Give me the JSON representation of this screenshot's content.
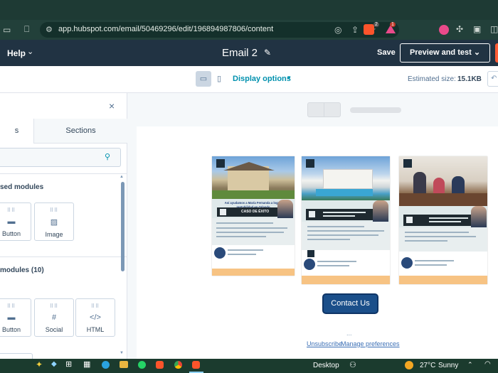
{
  "browser": {
    "url": "app.hubspot.com/email/50469296/edit/196894987806/content",
    "brave_badge": "2",
    "alert_badge": "1"
  },
  "header": {
    "help_label": "Help",
    "email_title": "Email 2",
    "save_label": "Save",
    "preview_label": "Preview and test"
  },
  "toolbar": {
    "display_options_label": "Display options",
    "estimated_size_label": "Estimated size:",
    "estimated_size_value": "15.1KB"
  },
  "panel": {
    "tab_modules": "s",
    "tab_sections": "Sections",
    "section1_title": "sed modules",
    "section1_modules": [
      {
        "label": "Button",
        "icon": "button-icon"
      },
      {
        "label": "Image",
        "icon": "image-icon"
      }
    ],
    "section2_title": "modules (10)",
    "section2_modules": [
      {
        "label": "Button",
        "icon": "button-icon"
      },
      {
        "label": "Social",
        "icon": "social-icon"
      },
      {
        "label": "HTML",
        "icon": "code-icon",
        "glyph": "</>"
      }
    ]
  },
  "email": {
    "card1_headline": "Así ayudamos a María Fernanda a lograr rentabilidad en Orlando",
    "card1_banner": "CASO DE ÉXITO",
    "contact_button": "Contact Us",
    "ellipsis": "...",
    "unsubscribe_label": "Unsubscribe",
    "manage_prefs_label": "Manage preferences"
  },
  "taskbar": {
    "desktop_label": "Desktop",
    "weather_temp": "27°C",
    "weather_desc": "Sunny"
  },
  "colors": {
    "hs_header": "#213343",
    "accent_orange": "#ff5c35",
    "link_blue": "#0091ae",
    "contact_btn": "#1b4f8a",
    "chrome_bg": "#1e3a34"
  }
}
